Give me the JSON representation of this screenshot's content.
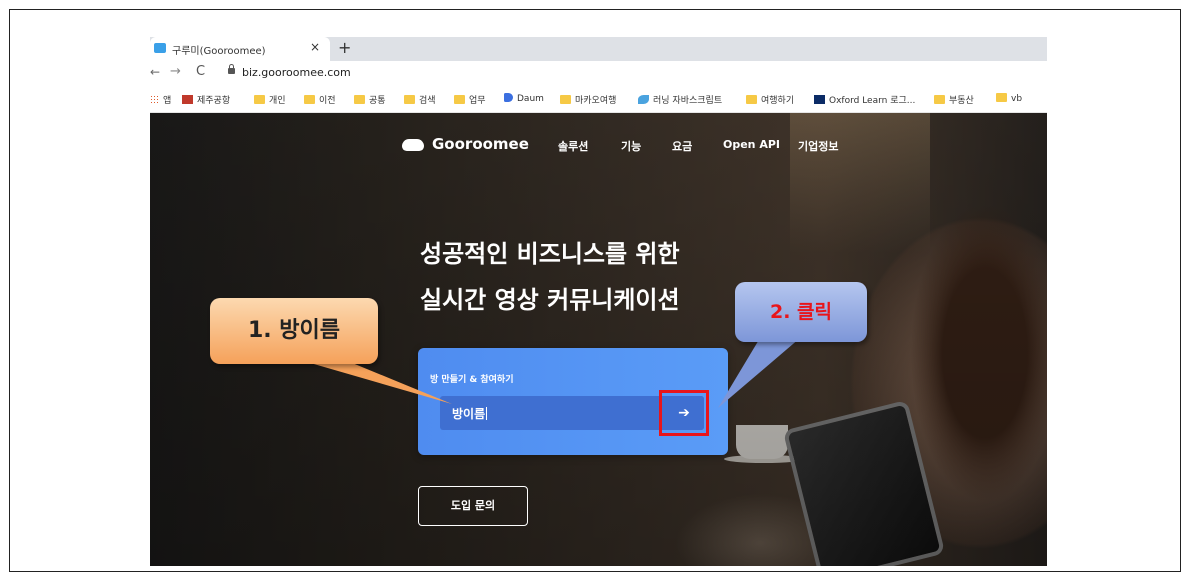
{
  "browser": {
    "tab": {
      "title": "구루미(Gooroomee)",
      "close": "×",
      "new_tab": "+"
    },
    "nav": {
      "back": "←",
      "forward": "→",
      "reload": "C"
    },
    "url": "biz.gooroomee.com",
    "bookmarks": [
      {
        "label": "앱",
        "icon": "apps-grid-icon"
      },
      {
        "label": "제주공항",
        "icon": "kac-icon"
      },
      {
        "label": "개인",
        "icon": "folder-icon"
      },
      {
        "label": "이전",
        "icon": "folder-icon"
      },
      {
        "label": "공통",
        "icon": "folder-icon"
      },
      {
        "label": "검색",
        "icon": "folder-icon"
      },
      {
        "label": "업무",
        "icon": "folder-icon"
      },
      {
        "label": "Daum",
        "icon": "daum-icon"
      },
      {
        "label": "마카오여행",
        "icon": "folder-icon"
      },
      {
        "label": "러닝 자바스크립트",
        "icon": "fish-icon"
      },
      {
        "label": "여행하기",
        "icon": "folder-icon"
      },
      {
        "label": "Oxford Learn 로그...",
        "icon": "oup-icon"
      },
      {
        "label": "부동산",
        "icon": "folder-icon"
      },
      {
        "label": "vb",
        "icon": "folder-icon"
      }
    ]
  },
  "site": {
    "logo": "Gooroomee",
    "menu": [
      "솔루션",
      "기능",
      "요금",
      "Open API",
      "기업정보"
    ],
    "headline": [
      "성공적인 비즈니스를 위한",
      "실시간 영상 커뮤니케이션"
    ],
    "room_card": {
      "label": "방 만들기 & 참여하기",
      "input_value": "방이름",
      "go_arrow": "➔"
    },
    "inquiry_button": "도입 문의"
  },
  "annotations": {
    "step1": "1. 방이름",
    "step2": "2. 클릭",
    "highlight_color": "#e8151b"
  }
}
